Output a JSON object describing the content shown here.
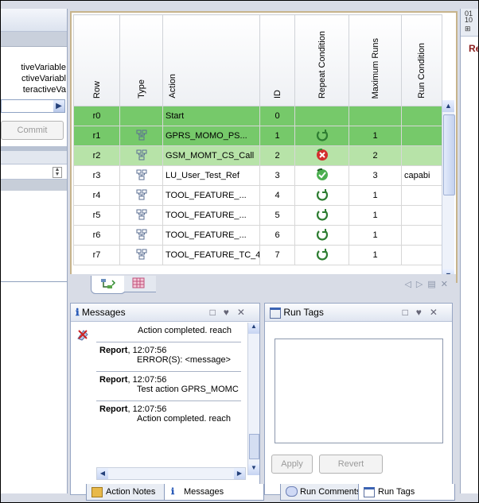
{
  "left_panel": {
    "variables": [
      "tiveVariable",
      "ctiveVariabl",
      "teractiveVa"
    ],
    "commit_label": "Commit"
  },
  "table": {
    "headers": [
      "Row",
      "Type",
      "Action",
      "ID",
      "Repeat Condition",
      "Maximum Runs",
      "Run Condition"
    ],
    "rows": [
      {
        "row": "r0",
        "type": "",
        "action": "Start",
        "id": "0",
        "repeat": "",
        "max_runs": "",
        "run_condition": "",
        "style": "g1"
      },
      {
        "row": "r1",
        "type": "flow-icon",
        "action": "GPRS_MOMO_PS...",
        "id": "1",
        "repeat": "refresh-icon",
        "max_runs": "1",
        "run_condition": "",
        "style": "g1"
      },
      {
        "row": "r2",
        "type": "flow-icon",
        "action": "GSM_MOMT_CS_Call",
        "id": "2",
        "repeat": "error-icon",
        "max_runs": "2",
        "run_condition": "",
        "style": "g2"
      },
      {
        "row": "r3",
        "type": "flow-icon",
        "action": "LU_User_Test_Ref",
        "id": "3",
        "repeat": "success-icon",
        "max_runs": "3",
        "run_condition": "capabi",
        "style": "n"
      },
      {
        "row": "r4",
        "type": "flow-icon",
        "action": "TOOL_FEATURE_...",
        "id": "4",
        "repeat": "refresh-icon",
        "max_runs": "1",
        "run_condition": "",
        "style": "n"
      },
      {
        "row": "r5",
        "type": "flow-icon",
        "action": "TOOL_FEATURE_...",
        "id": "5",
        "repeat": "refresh-icon",
        "max_runs": "1",
        "run_condition": "",
        "style": "n"
      },
      {
        "row": "r6",
        "type": "flow-icon",
        "action": "TOOL_FEATURE_...",
        "id": "6",
        "repeat": "refresh-icon",
        "max_runs": "1",
        "run_condition": "",
        "style": "n"
      },
      {
        "row": "r7",
        "type": "flow-icon",
        "action": "TOOL_FEATURE_TC_4",
        "id": "7",
        "repeat": "refresh-icon",
        "max_runs": "1",
        "run_condition": "",
        "style": "n"
      }
    ]
  },
  "messages_panel": {
    "title": "Messages",
    "entries": [
      {
        "source": "",
        "time": "",
        "text": "Action completed. reach"
      },
      {
        "source": "Report",
        "time": ", 12:07:56",
        "text": "ERROR(S): <message>"
      },
      {
        "source": "Report",
        "time": ", 12:07:56",
        "text": "Test action GPRS_MOMC"
      },
      {
        "source": "Report",
        "time": ", 12:07:56",
        "text": "Action completed. reach"
      }
    ],
    "tabs": [
      "Action Notes",
      "Messages"
    ]
  },
  "run_tags_panel": {
    "title": "Run Tags",
    "apply_label": "Apply",
    "revert_label": "Revert",
    "tabs": [
      "Run Comments",
      "Run Tags"
    ]
  },
  "right_panel": {
    "label": "Re"
  },
  "colors": {
    "row_green": "#76c96a",
    "row_light_green": "#b7e3a8",
    "selection_border": "#c7b48c",
    "error_red": "#d32f2f",
    "ok_green": "#2e8b2e"
  }
}
